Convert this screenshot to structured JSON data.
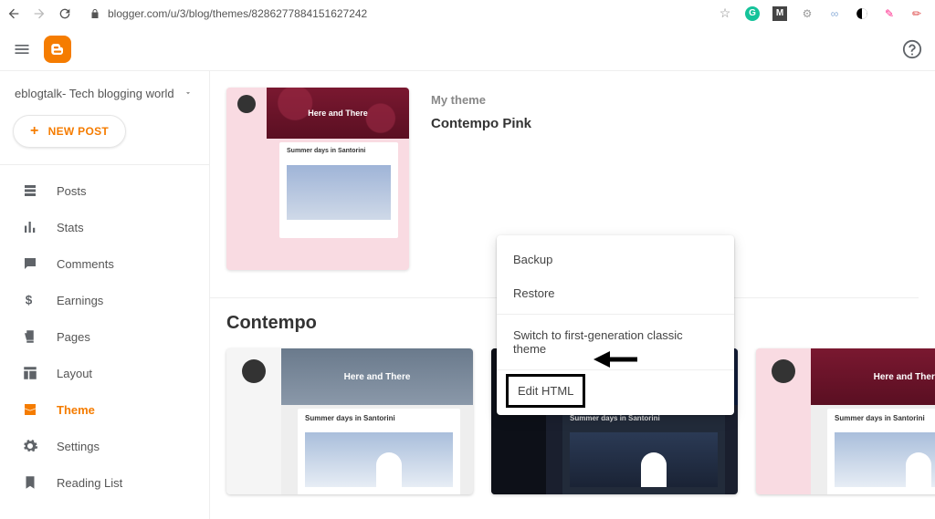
{
  "browser": {
    "url": "blogger.com/u/3/blog/themes/8286277884151627242"
  },
  "blog_title": "eblogtalk- Tech blogging world",
  "new_post_label": "NEW POST",
  "sidebar": {
    "items": [
      {
        "label": "Posts"
      },
      {
        "label": "Stats"
      },
      {
        "label": "Comments"
      },
      {
        "label": "Earnings"
      },
      {
        "label": "Pages"
      },
      {
        "label": "Layout"
      },
      {
        "label": "Theme"
      },
      {
        "label": "Settings"
      },
      {
        "label": "Reading List"
      }
    ]
  },
  "my_theme": {
    "label": "My theme",
    "name": "Contempo Pink",
    "preview": {
      "hero_title": "Here and There",
      "post_title": "Summer days in Santorini"
    }
  },
  "dropdown": {
    "backup": "Backup",
    "restore": "Restore",
    "switch_classic": "Switch to first-generation classic theme",
    "edit_html": "Edit HTML"
  },
  "section": {
    "title": "Contempo"
  },
  "gallery": {
    "hero_title": "Here and There",
    "post_title": "Summer days in Santorini"
  }
}
